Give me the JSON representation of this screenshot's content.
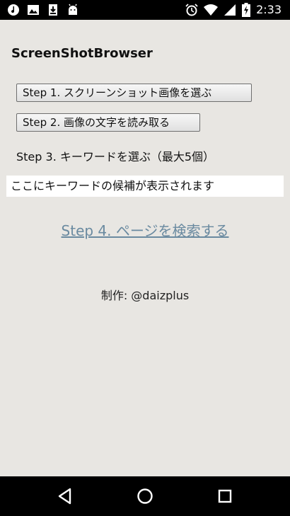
{
  "status_bar": {
    "time": "2:33",
    "left_icons": [
      "music-icon",
      "image-icon",
      "download-icon",
      "android-icon"
    ],
    "right_icons": [
      "alarm-icon",
      "wifi-icon",
      "signal-icon",
      "battery-charging-icon"
    ]
  },
  "app": {
    "title": "ScreenShotBrowser"
  },
  "steps": {
    "step1_label": "Step 1. スクリーンショット画像を選ぶ",
    "step2_label": "Step 2. 画像の文字を読み取る",
    "step3_label": "Step 3. キーワードを選ぶ（最大5個）",
    "keyword_placeholder": "ここにキーワードの候補が表示されます",
    "step4_label": "Step 4. ページを検索する"
  },
  "footer": {
    "credit": "制作: @daizplus"
  },
  "colors": {
    "background": "#e8e6e2",
    "link": "#6a8aa0",
    "bars": "#000000"
  },
  "nav_bar": {
    "icons": [
      "back-icon",
      "home-icon",
      "recents-icon"
    ]
  }
}
